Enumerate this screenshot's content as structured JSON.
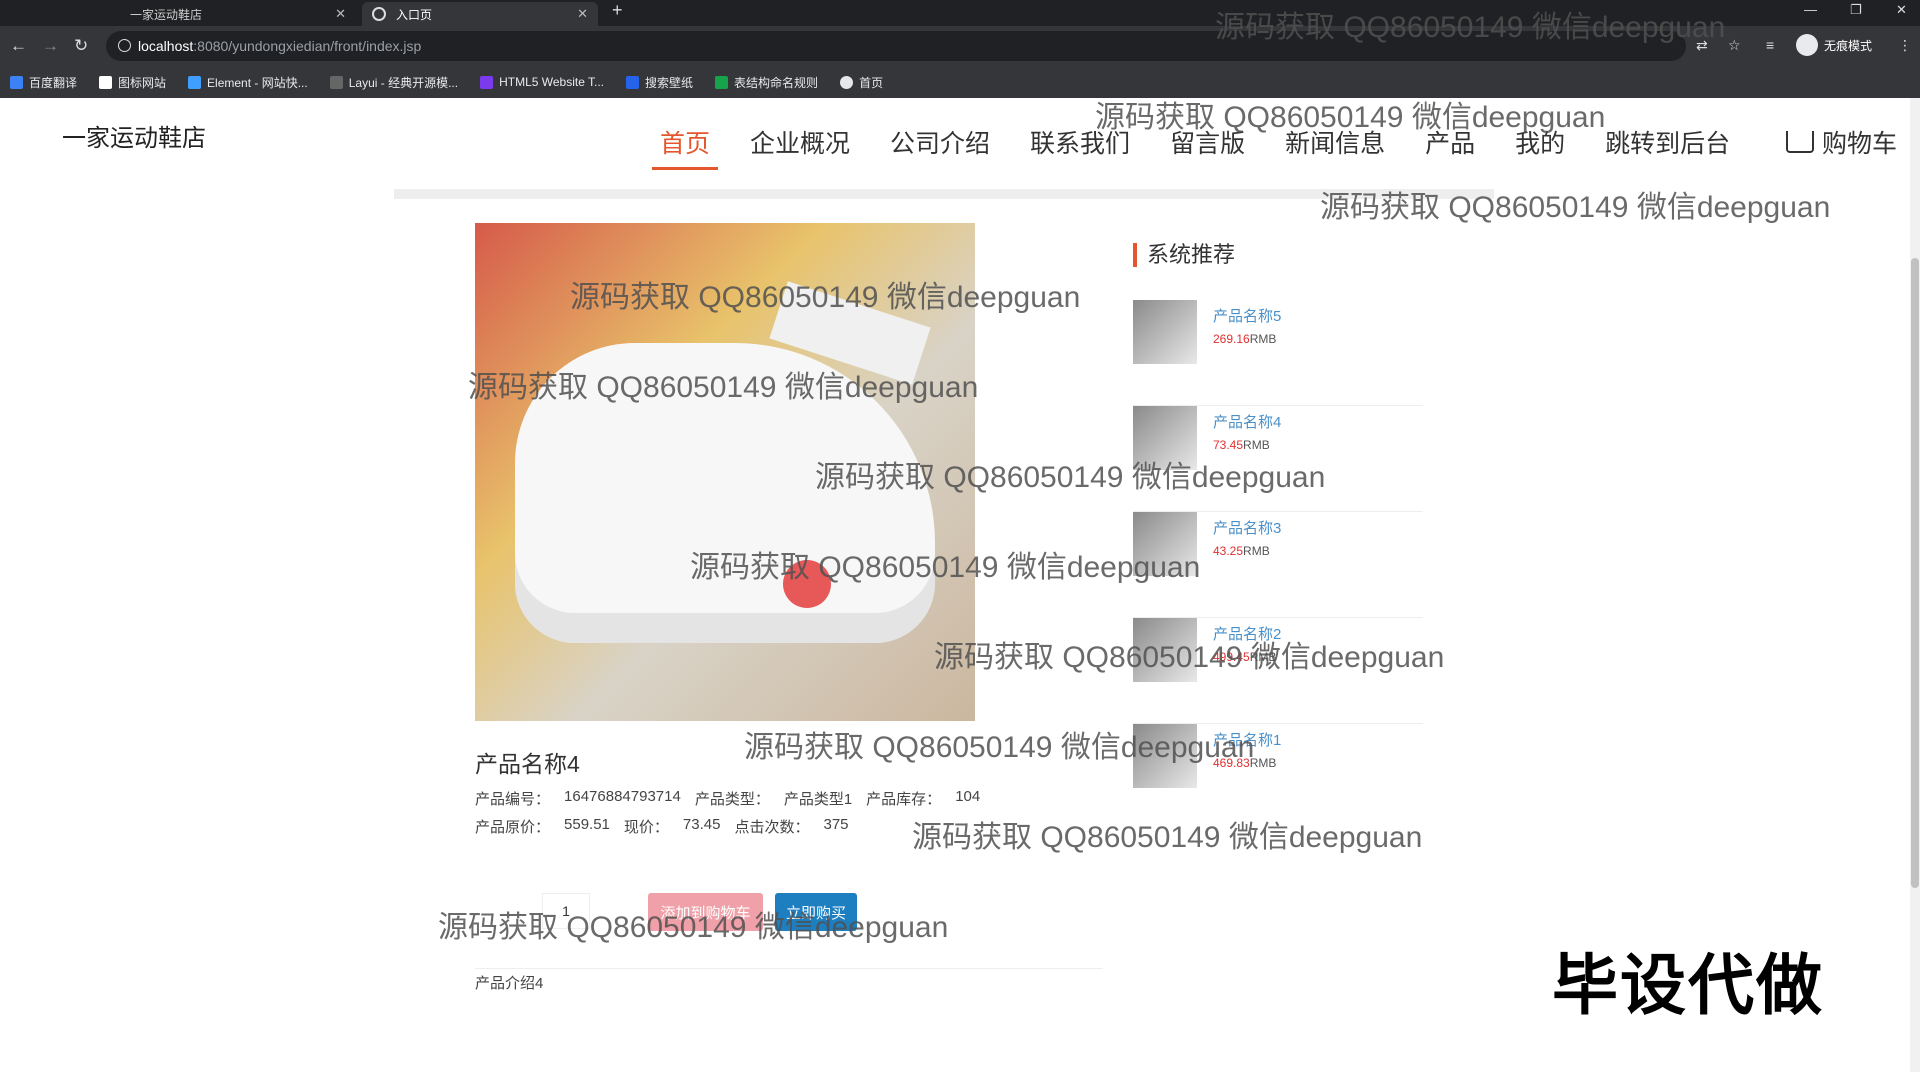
{
  "browser": {
    "tabs": [
      {
        "label": "一家运动鞋店",
        "active": false
      },
      {
        "label": "入口页",
        "active": true
      }
    ],
    "url_host": "localhost",
    "url_path": ":8080/yundongxiedian/front/index.jsp",
    "incognito_label": "无痕模式",
    "bookmarks": [
      "百度翻译",
      "图标网站",
      "Element - 网站快...",
      "Layui - 经典开源模...",
      "HTML5 Website T...",
      "搜索壁纸",
      "表结构命名规则",
      "首页"
    ]
  },
  "site": {
    "title": "一家运动鞋店",
    "nav": [
      "首页",
      "企业概况",
      "公司介绍",
      "联系我们",
      "留言版",
      "新闻信息",
      "产品",
      "我的",
      "跳转到后台"
    ],
    "cart": "购物车"
  },
  "product": {
    "name": "产品名称4",
    "row1": [
      {
        "label": "产品编号：",
        "value": "16476884793714"
      },
      {
        "label": "产品类型：",
        "value": "产品类型1"
      },
      {
        "label": "产品库存：",
        "value": "104"
      }
    ],
    "row2": [
      {
        "label": "产品原价：",
        "value": "559.51"
      },
      {
        "label": "现价：",
        "value": "73.45"
      },
      {
        "label": "点击次数：",
        "value": "375"
      }
    ],
    "quantity": "1",
    "add_to_cart": "添加到购物车",
    "buy_now": "立即购买",
    "intro": "产品介绍4"
  },
  "recommend": {
    "title": "系统推荐",
    "items": [
      {
        "name": "产品名称5",
        "price": "269.16",
        "unit": "RMB"
      },
      {
        "name": "产品名称4",
        "price": "73.45",
        "unit": "RMB"
      },
      {
        "name": "产品名称3",
        "price": "43.25",
        "unit": "RMB"
      },
      {
        "name": "产品名称2",
        "price": "499.45",
        "unit": "RMB"
      },
      {
        "name": "产品名称1",
        "price": "469.83",
        "unit": "RMB"
      }
    ]
  },
  "watermark_text": "源码获取 QQ86050149 微信deepguan",
  "stamp_text": "毕设代做"
}
